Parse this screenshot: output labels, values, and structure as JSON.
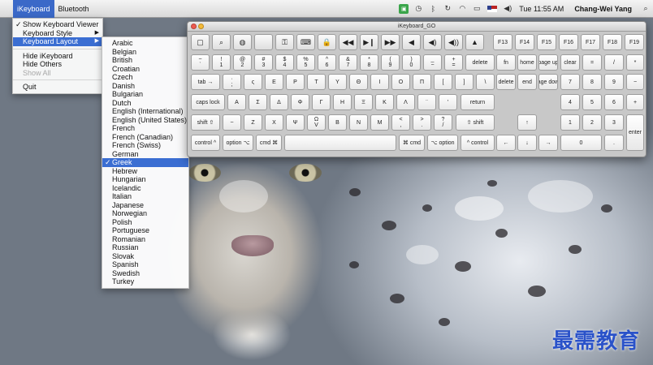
{
  "menubar": {
    "apple_icon": "",
    "app_name": "iKeyboard",
    "menu_bluetooth": "Bluetooth",
    "clock": "Tue 11:55 AM",
    "user": "Chang-Wei Yang"
  },
  "ikeyboard_menu": {
    "items": [
      {
        "label": "Show Keyboard Viewer",
        "checked": true
      },
      {
        "label": "Keyboard Style"
      },
      {
        "label": "Keyboard Layout"
      },
      {
        "label": "Hide iKeyboard"
      },
      {
        "label": "Hide Others"
      },
      {
        "label": "Show All",
        "disabled": true
      },
      {
        "label": "Quit"
      }
    ]
  },
  "layout_menu": {
    "items": [
      "Arabic",
      "Belgian",
      "British",
      "Croatian",
      "Czech",
      "Danish",
      "Bulgarian",
      "Dutch",
      "English (International)",
      "English (United States)",
      "French",
      "French (Canadian)",
      "French (Swiss)",
      "German",
      "Greek",
      "Hebrew",
      "Hungarian",
      "Icelandic",
      "Italian",
      "Japanese",
      "Norwegian",
      "Polish",
      "Portuguese",
      "Romanian",
      "Russian",
      "Slovak",
      "Spanish",
      "Swedish",
      "Turkey"
    ],
    "selected": "Greek"
  },
  "keyboard_window": {
    "title": "iKeyboard_GO",
    "fkeys": [
      "F13",
      "F14",
      "F15",
      "F16",
      "F17",
      "F18",
      "F19"
    ],
    "labels": {
      "delete": "delete",
      "fn": "fn",
      "home": "home",
      "page_up": "page up",
      "clear": "clear",
      "eq": "=",
      "div": "/",
      "mul": "*",
      "tab": "tab →",
      "fwd_delete": "delete",
      "end": "end",
      "page_down": "page down",
      "n7": "7",
      "n8": "8",
      "n9": "9",
      "minus": "−",
      "caps": "caps lock",
      "return": "return",
      "n4": "4",
      "n5": "5",
      "n6": "6",
      "plus": "+",
      "shift_l": "shift ⇧",
      "shift_r": "⇧ shift",
      "up": "↑",
      "n1": "1",
      "n2": "2",
      "n3": "3",
      "enter": "enter",
      "control_l": "control ^",
      "option_l": "option ⌥",
      "cmd_l": "cmd ⌘",
      "cmd_r": "⌘ cmd",
      "option_r": "⌥ option",
      "control_r": "^ control",
      "left": "←",
      "down": "↓",
      "right": "→",
      "n0": "0",
      "dot": "."
    },
    "row_q": [
      {
        "top": "·",
        "bottom": ";"
      },
      {
        "top": "ς",
        "bottom": ""
      },
      {
        "top": "Ε",
        "bottom": ""
      },
      {
        "top": "Ρ",
        "bottom": ""
      },
      {
        "top": "Τ",
        "bottom": ""
      },
      {
        "top": "Υ",
        "bottom": ""
      },
      {
        "top": "Θ",
        "bottom": ""
      },
      {
        "top": "Ι",
        "bottom": ""
      },
      {
        "top": "Ο",
        "bottom": ""
      },
      {
        "top": "Π",
        "bottom": ""
      },
      {
        "top": "",
        "bottom": "["
      },
      {
        "top": "",
        "bottom": "]"
      },
      {
        "top": "",
        "bottom": "\\"
      }
    ],
    "row_a": [
      {
        "top": "",
        "bottom": "Α"
      },
      {
        "top": "",
        "bottom": "Σ"
      },
      {
        "top": "Δ",
        "bottom": ""
      },
      {
        "top": "Φ",
        "bottom": ""
      },
      {
        "top": "Γ",
        "bottom": ""
      },
      {
        "top": "Η",
        "bottom": ""
      },
      {
        "top": "Ξ",
        "bottom": ""
      },
      {
        "top": "Κ",
        "bottom": ""
      },
      {
        "top": "Λ",
        "bottom": ""
      },
      {
        "top": "¨",
        "bottom": ""
      },
      {
        "top": "'",
        "bottom": ""
      }
    ],
    "row_z": [
      {
        "top": "~",
        "bottom": ""
      },
      {
        "top": "",
        "bottom": "Ζ"
      },
      {
        "top": "",
        "bottom": "Χ"
      },
      {
        "top": "",
        "bottom": "Ψ"
      },
      {
        "top": "Ω",
        "bottom": "V"
      },
      {
        "top": "",
        "bottom": "Β"
      },
      {
        "top": "",
        "bottom": "Ν"
      },
      {
        "top": "",
        "bottom": "Μ"
      },
      {
        "top": "<",
        "bottom": ","
      },
      {
        "top": ">",
        "bottom": "."
      },
      {
        "top": "?",
        "bottom": "/"
      }
    ],
    "row_num": [
      {
        "top": "~",
        "bottom": "`"
      },
      {
        "top": "!",
        "bottom": "1"
      },
      {
        "top": "@",
        "bottom": "2"
      },
      {
        "top": "#",
        "bottom": "3"
      },
      {
        "top": "$",
        "bottom": "4"
      },
      {
        "top": "%",
        "bottom": "5"
      },
      {
        "top": "^",
        "bottom": "6"
      },
      {
        "top": "&",
        "bottom": "7"
      },
      {
        "top": "*",
        "bottom": "8"
      },
      {
        "top": "(",
        "bottom": "9"
      },
      {
        "top": ")",
        "bottom": "0"
      },
      {
        "top": "_",
        "bottom": "−"
      },
      {
        "top": "+",
        "bottom": "="
      }
    ],
    "toolbar_icons": [
      "window-icon",
      "magnifier-icon",
      "globe-icon",
      "apple-icon",
      "lock-keyhole-icon",
      "keyboard-icon",
      "lock-icon",
      "rewind-icon",
      "play-pause-icon",
      "fast-forward-icon",
      "mute-icon",
      "volume-down-icon",
      "volume-up-icon",
      "eject-icon"
    ]
  },
  "watermark": "最需教育"
}
